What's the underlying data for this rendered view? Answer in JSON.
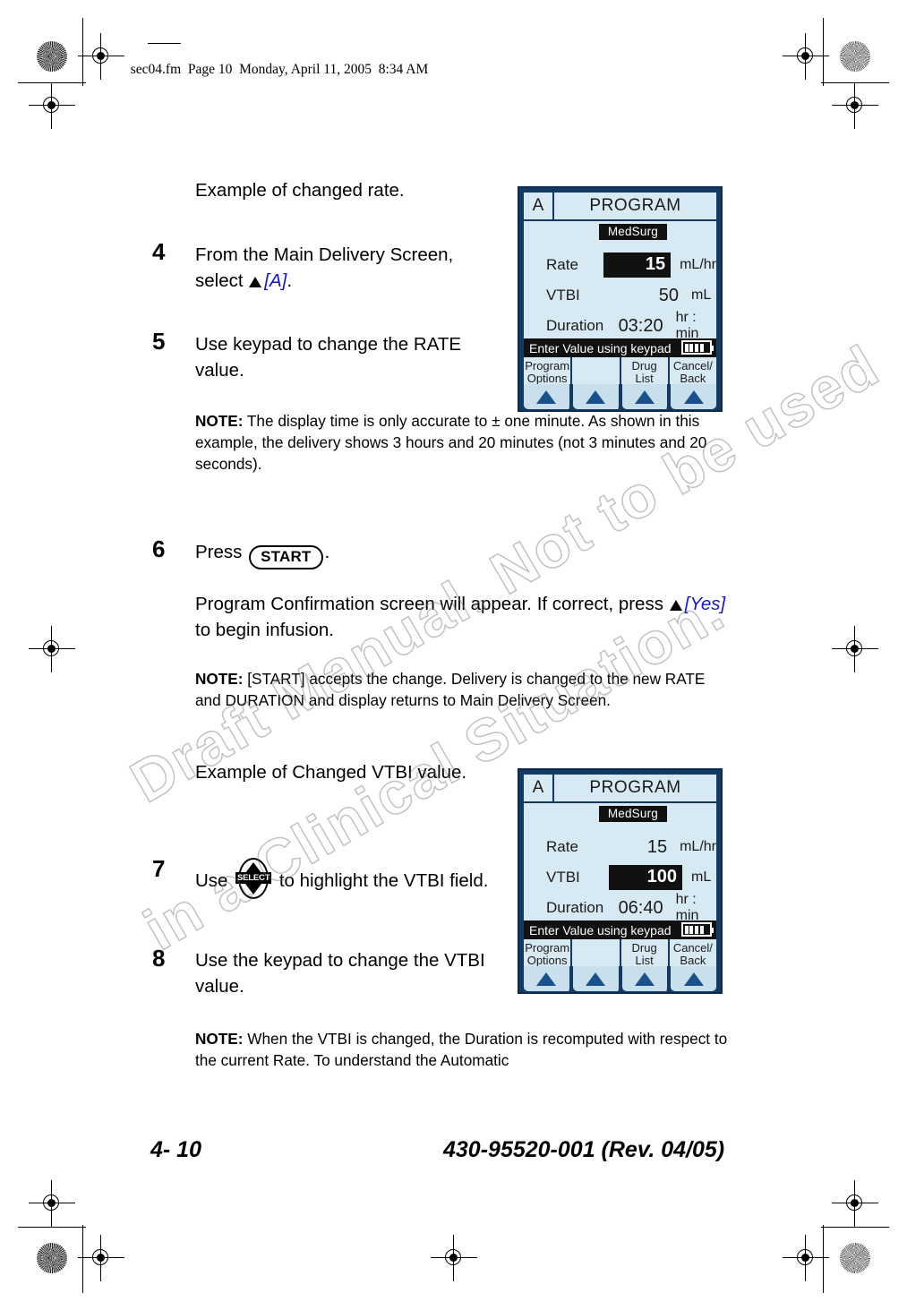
{
  "page": {
    "slug": "sec04.fm  Page 10  Monday, April 11, 2005  8:34 AM",
    "watermark_line1": "Draft Manual. Not to be used",
    "watermark_line2": "in a Clinical Situation."
  },
  "body": {
    "intro_rate": "Example of changed rate.",
    "steps": [
      {
        "num": "4",
        "text_before": "From the Main Delivery Screen, select ",
        "bracket": "[A]",
        "text_after": "."
      },
      {
        "num": "5",
        "text_before": "Use keypad to change the RATE value.",
        "bracket": "",
        "text_after": ""
      },
      {
        "num": "6",
        "text_before": "Press ",
        "key": "START",
        "text_after": "."
      },
      {
        "num": "7",
        "text_before": "Use ",
        "key": "SELECT",
        "text_after": " to highlight the VTBI field."
      },
      {
        "num": "8",
        "text_before": "Use the keypad to change the VTBI value.",
        "bracket": "",
        "text_after": ""
      }
    ],
    "note1_label": "NOTE:",
    "note1_text": " The display time is only accurate to ± one minute. As shown in this example, the delivery shows 3 hours and 20 minutes (not 3 minutes and 20 seconds).",
    "confirm_before": "Program Confirmation screen will appear. If correct, press ",
    "confirm_bracket": "[Yes]",
    "confirm_after": " to begin infusion.",
    "note2_label": "NOTE:",
    "note2_text": " [START] accepts the change. Delivery is changed to the new RATE and DURATION and display returns to Main Delivery Screen.",
    "intro_vtbi": "Example of Changed VTBI value.",
    "note3_label": "NOTE:",
    "note3_text": " When the VTBI is changed, the Duration is recomputed with respect to the current Rate. To understand the Automatic"
  },
  "device1": {
    "channel": "A",
    "title": "PROGRAM",
    "profile": "MedSurg",
    "rows": [
      {
        "label": "Rate",
        "value": "15",
        "unit": "mL/hr",
        "highlighted": true
      },
      {
        "label": "VTBI",
        "value": "50",
        "unit": "mL",
        "highlighted": false
      },
      {
        "label": "Duration",
        "value": "03:20",
        "unit": "hr : min",
        "highlighted": false
      }
    ],
    "status": "Enter Value using keypad",
    "battery_bars": 4,
    "battery_total": 5,
    "softkeys": [
      {
        "line1": "Program",
        "line2": "Options"
      },
      {
        "line1": "",
        "line2": ""
      },
      {
        "line1": "Drug",
        "line2": "List"
      },
      {
        "line1": "Cancel/",
        "line2": "Back"
      }
    ]
  },
  "device2": {
    "channel": "A",
    "title": "PROGRAM",
    "profile": "MedSurg",
    "rows": [
      {
        "label": "Rate",
        "value": "15",
        "unit": "mL/hr",
        "highlighted": false
      },
      {
        "label": "VTBI",
        "value": "100",
        "unit": "mL",
        "highlighted": true
      },
      {
        "label": "Duration",
        "value": "06:40",
        "unit": "hr : min",
        "highlighted": false
      }
    ],
    "status": "Enter Value using keypad",
    "battery_bars": 4,
    "battery_total": 5,
    "softkeys": [
      {
        "line1": "Program",
        "line2": "Options"
      },
      {
        "line1": "",
        "line2": ""
      },
      {
        "line1": "Drug",
        "line2": "List"
      },
      {
        "line1": "Cancel/",
        "line2": "Back"
      }
    ]
  },
  "footer": {
    "page_number": "4- 10",
    "document_id": "430-95520-001 (Rev. 04/05)"
  },
  "colors": {
    "device_bezel": "#123a63",
    "screen_bg": "#d7eaf4",
    "highlight_bg": "#111111",
    "arrow_blue": "#19518d",
    "link_blue": "#1414d2"
  }
}
